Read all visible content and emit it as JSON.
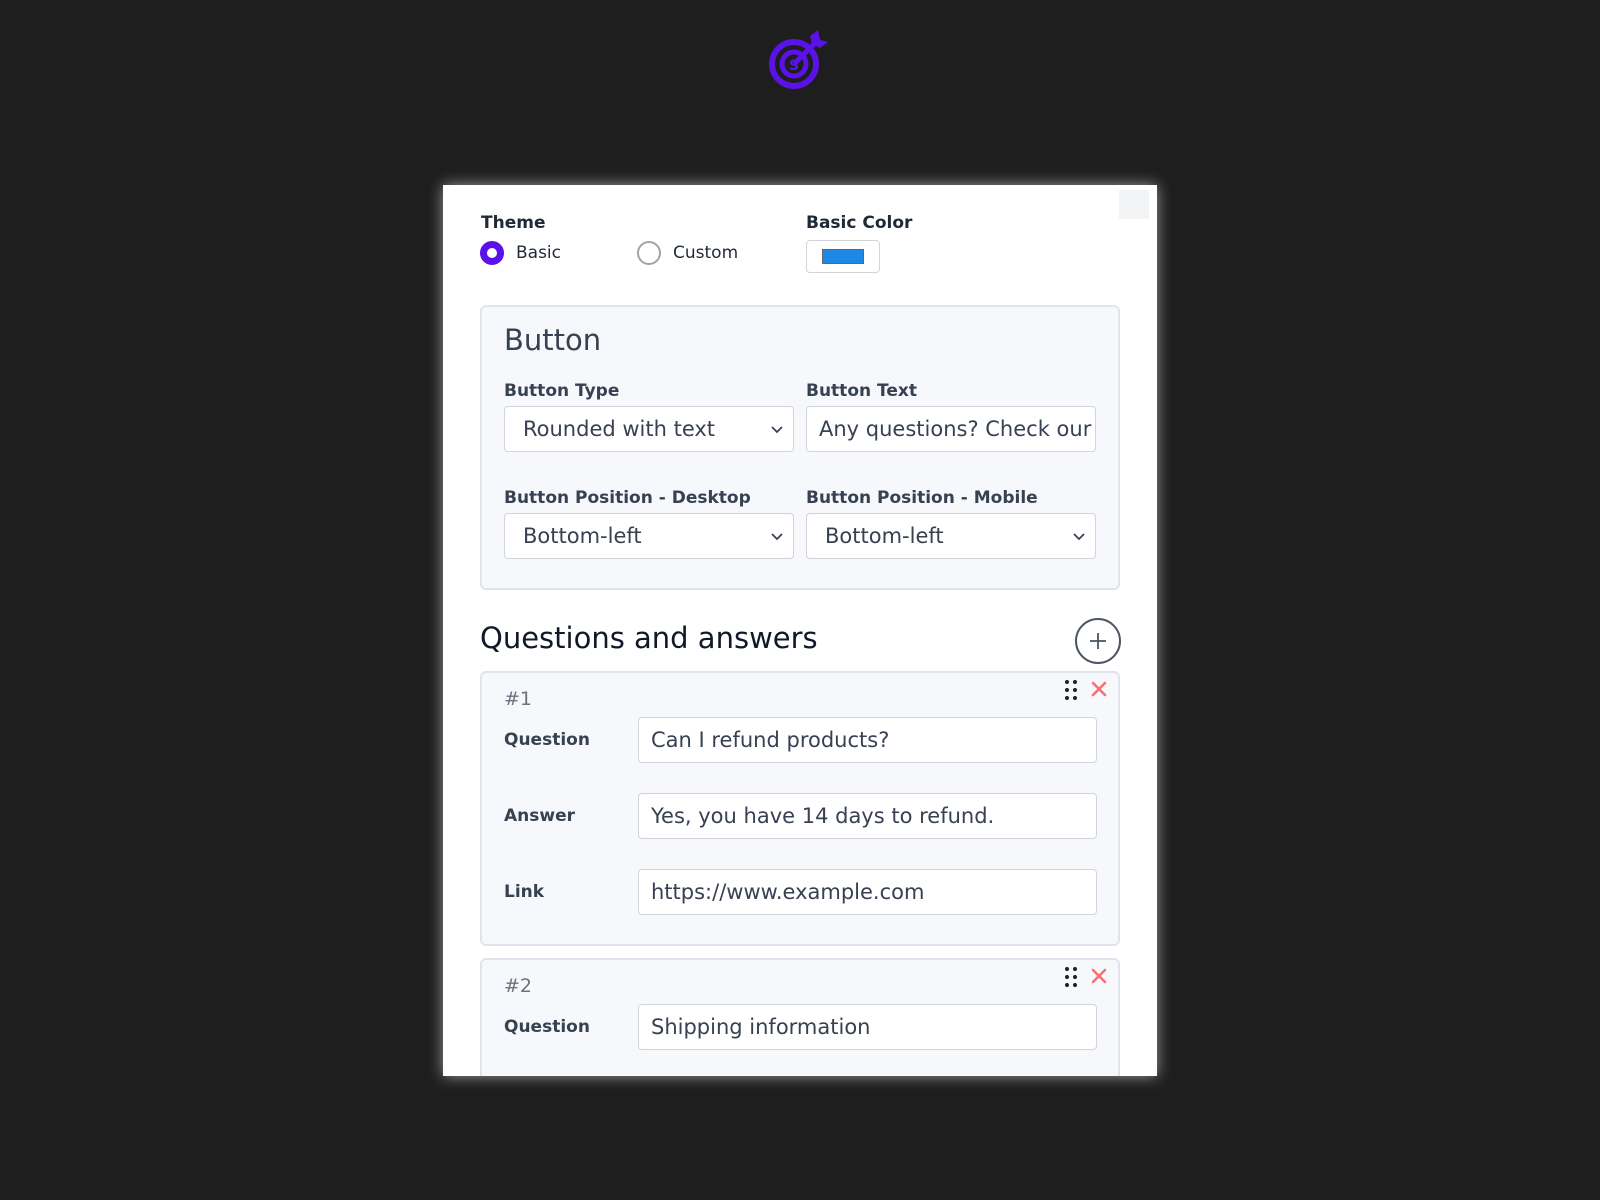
{
  "theme": {
    "label": "Theme",
    "options": [
      {
        "label": "Basic",
        "checked": true
      },
      {
        "label": "Custom",
        "checked": false
      }
    ]
  },
  "basic_color": {
    "label": "Basic Color",
    "value": "#1e88e5"
  },
  "button_section": {
    "title": "Button",
    "type_label": "Button Type",
    "type_value": "Rounded with text",
    "text_label": "Button Text",
    "text_value": "Any questions? Check our FAQ",
    "desktop_label": "Button Position - Desktop",
    "desktop_value": "Bottom-left",
    "mobile_label": "Button Position - Mobile",
    "mobile_value": "Bottom-left"
  },
  "qa": {
    "heading": "Questions and answers",
    "items": [
      {
        "number": "#1",
        "question_label": "Question",
        "question": "Can I refund products?",
        "answer_label": "Answer",
        "answer": "Yes, you have 14 days to refund.",
        "link_label": "Link",
        "link": "https://www.example.com"
      },
      {
        "number": "#2",
        "question_label": "Question",
        "question": "Shipping information"
      }
    ]
  },
  "colors": {
    "accent": "#5b12e8",
    "delete": "#f87171",
    "background": "#1e1e1e"
  }
}
